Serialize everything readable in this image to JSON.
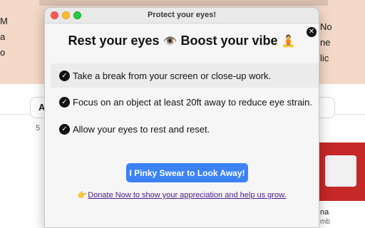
{
  "background": {
    "left_fragments": [
      "M",
      "a",
      "o",
      "A",
      "5"
    ],
    "right_fragments": [
      "No",
      "ne",
      "lic",
      "na",
      "mb"
    ]
  },
  "window": {
    "title": "Protect your eyes!",
    "close_symbol": "✕"
  },
  "popup": {
    "headline_part1": "Rest your eyes",
    "eye_emoji": "👁️",
    "headline_part2": "Boost your vibe",
    "lotus_emoji": "🧘",
    "tips": [
      "Take a break from your screen or close-up work.",
      "Focus on an object at least 20ft away to reduce eye strain.",
      "Allow your eyes to rest and reset."
    ],
    "check_symbol": "✓",
    "button_label": "I Pinky Swear to Look Away!",
    "donate_icon": "👉",
    "donate_text": "Donate Now to show your appreciation and help us grow."
  },
  "colors": {
    "accent": "#3b82f6",
    "link": "#4a1a8c",
    "background_top": "#f5d9c8"
  }
}
